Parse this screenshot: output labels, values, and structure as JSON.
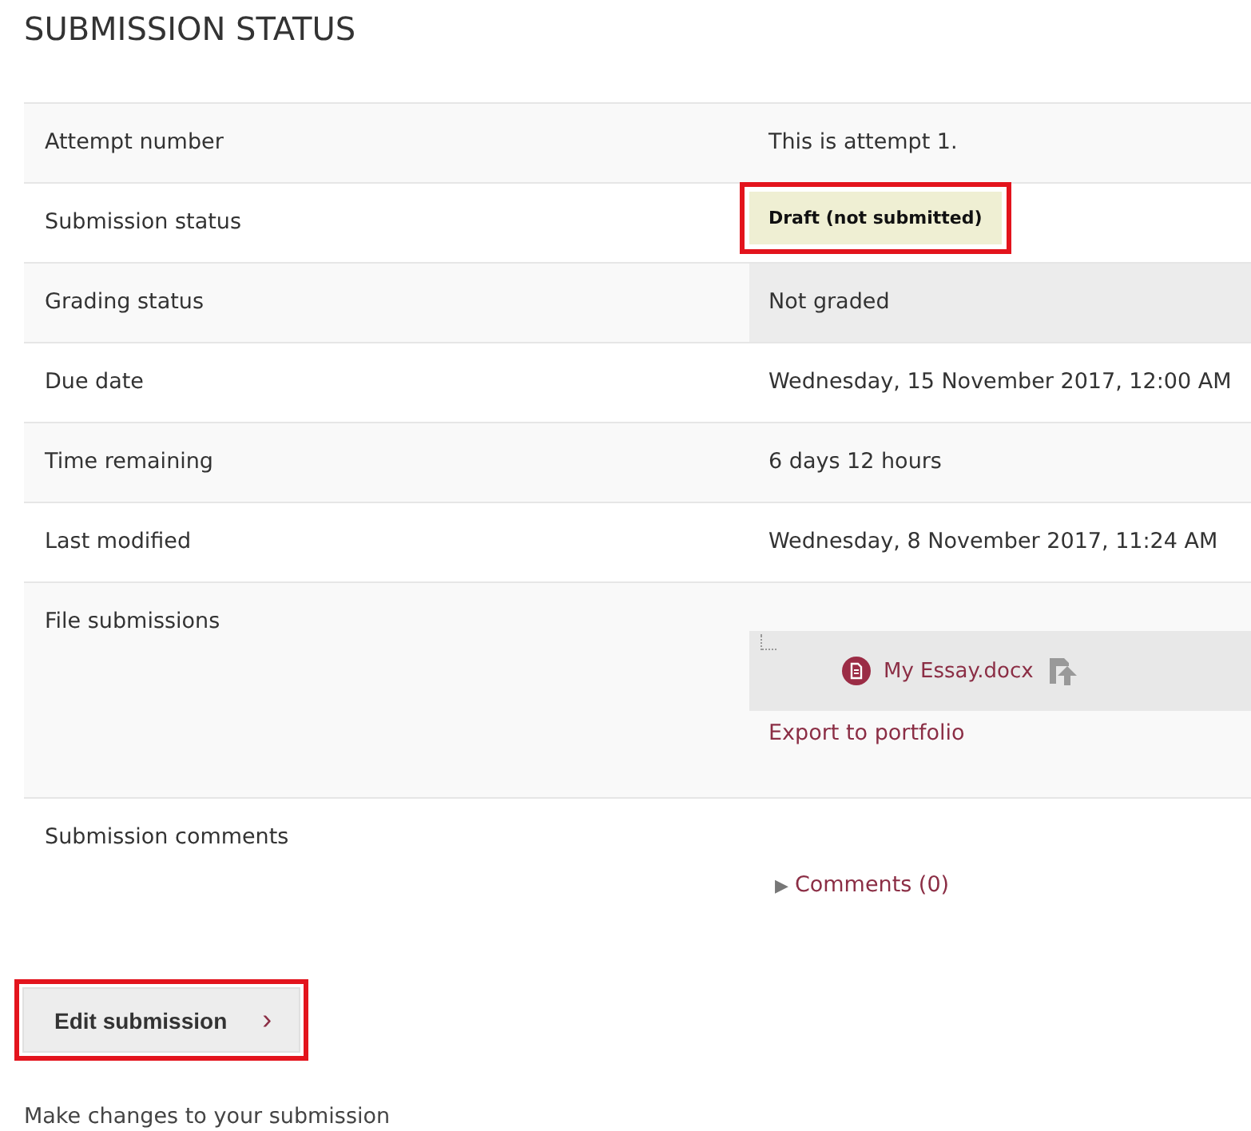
{
  "title": "SUBMISSION STATUS",
  "rows": [
    {
      "label": "Attempt number",
      "kind": "text",
      "value": "This is attempt 1.",
      "shaded": false
    },
    {
      "label": "Submission status",
      "kind": "badge",
      "value": "Draft (not submitted)",
      "highlighted": true
    },
    {
      "label": "Grading status",
      "kind": "text",
      "value": "Not graded",
      "shaded": true
    },
    {
      "label": "Due date",
      "kind": "text",
      "value": "Wednesday, 15 November 2017, 12:00 AM",
      "shaded": false
    },
    {
      "label": "Time remaining",
      "kind": "text",
      "value": "6 days 12 hours",
      "shaded": false
    },
    {
      "label": "Last modified",
      "kind": "text",
      "value": "Wednesday, 8 November 2017, 11:24 AM",
      "shaded": false
    },
    {
      "label": "File submissions",
      "kind": "files",
      "file": "My Essay.docx",
      "link": "Export to portfolio"
    },
    {
      "label": "Submission comments",
      "kind": "comments",
      "toggle": "▶",
      "link": "Comments (0)",
      "expanded": false
    }
  ],
  "button": {
    "label": "Edit submission",
    "icon": "›",
    "highlighted": true
  },
  "hint": "Make changes to your submission"
}
